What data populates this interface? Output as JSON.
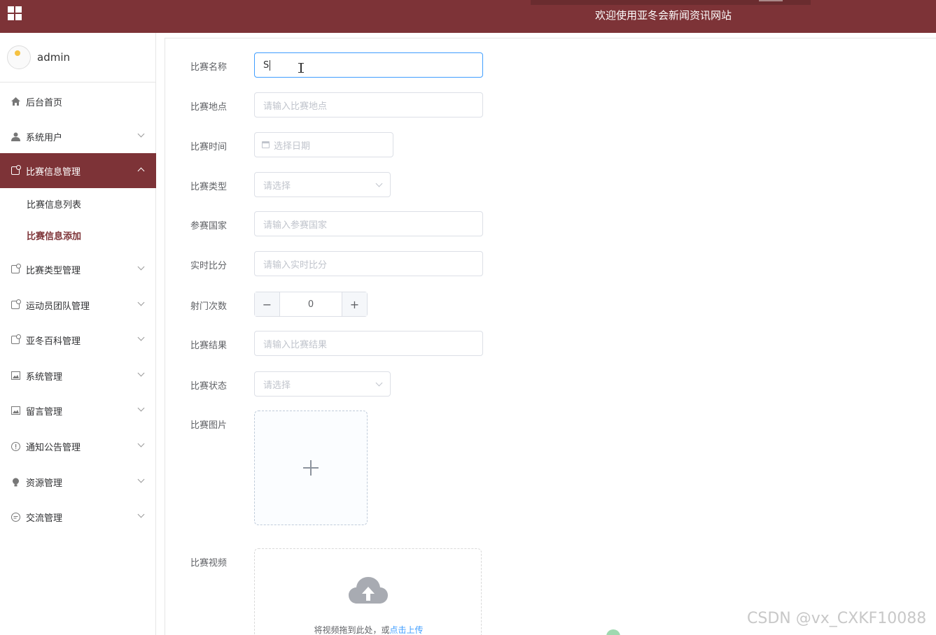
{
  "header": {
    "title": "欢迎使用亚冬会新闻资讯网站"
  },
  "user": {
    "name": "admin"
  },
  "sidebar": {
    "items": [
      {
        "label": "后台首页",
        "icon": "home-icon"
      },
      {
        "label": "系统用户",
        "icon": "user-icon"
      },
      {
        "label": "比赛信息管理",
        "icon": "document-icon",
        "expanded": true
      },
      {
        "label": "比赛类型管理",
        "icon": "document-icon"
      },
      {
        "label": "运动员团队管理",
        "icon": "document-icon"
      },
      {
        "label": "亚冬百科管理",
        "icon": "document-icon"
      },
      {
        "label": "系统管理",
        "icon": "image-icon"
      },
      {
        "label": "留言管理",
        "icon": "image-icon"
      },
      {
        "label": "通知公告管理",
        "icon": "info-icon"
      },
      {
        "label": "资源管理",
        "icon": "bulb-icon"
      },
      {
        "label": "交流管理",
        "icon": "chat-icon"
      }
    ],
    "subitems": [
      {
        "label": "比赛信息列表"
      },
      {
        "label": "比赛信息添加",
        "active": true
      }
    ]
  },
  "form": {
    "name": {
      "label": "比赛名称",
      "value": "S"
    },
    "location": {
      "label": "比赛地点",
      "placeholder": "请输入比赛地点"
    },
    "time": {
      "label": "比赛时间",
      "placeholder": "选择日期"
    },
    "type": {
      "label": "比赛类型",
      "placeholder": "请选择"
    },
    "country": {
      "label": "参赛国家",
      "placeholder": "请输入参赛国家"
    },
    "score": {
      "label": "实时比分",
      "placeholder": "请输入实时比分"
    },
    "shots": {
      "label": "射门次数",
      "value": "0",
      "minus": "−",
      "plus": "+"
    },
    "result": {
      "label": "比赛结果",
      "placeholder": "请输入比赛结果"
    },
    "status": {
      "label": "比赛状态",
      "placeholder": "请选择"
    },
    "image": {
      "label": "比赛图片"
    },
    "video": {
      "label": "比赛视频",
      "drag_text": "将视频拖到此处，或",
      "link_text": "点击上传"
    }
  },
  "watermark": "CSDN @vx_CXKF10088",
  "colors": {
    "brand": "#7d3337",
    "focus": "#409eff"
  }
}
